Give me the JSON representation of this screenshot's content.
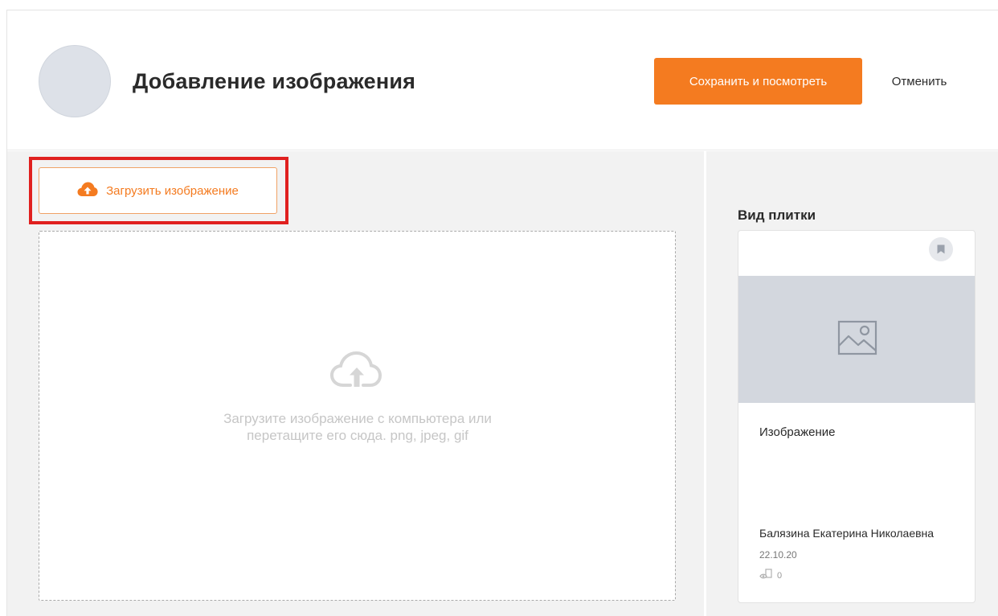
{
  "header": {
    "title": "Добавление изображения",
    "save_label": "Сохранить и посмотреть",
    "cancel_label": "Отменить"
  },
  "upload": {
    "button_label": "Загрузить изображение",
    "icon": "cloud-upload-icon",
    "dropzone_text": "Загрузите изображение с компьютера или перетащите его сюда. png, jpeg, gif"
  },
  "preview": {
    "heading": "Вид плитки",
    "item_title": "Изображение",
    "author": "Балязина Екатерина Николаевна",
    "date": "22.10.20",
    "views": "0",
    "bookmark_icon": "bookmark-icon",
    "image_icon": "image-placeholder-icon",
    "views_icon": "eye-icon"
  },
  "colors": {
    "accent": "#f47b20",
    "highlight": "#e0201f",
    "panel_bg": "#f2f2f2",
    "image_placeholder": "#d3d7de"
  }
}
